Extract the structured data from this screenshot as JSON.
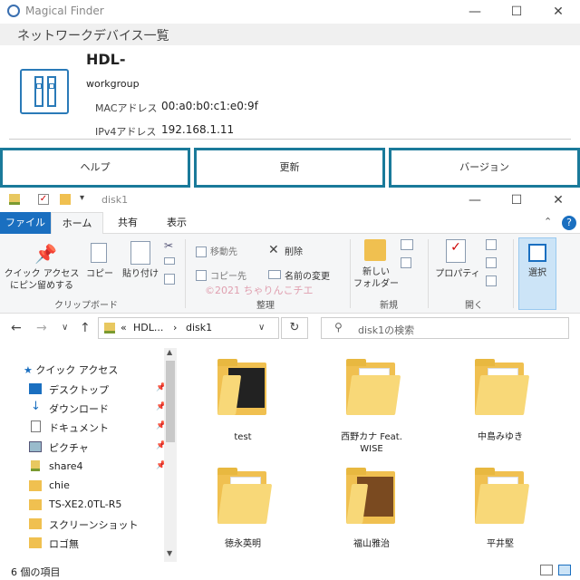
{
  "app": {
    "title": "Magical Finder",
    "subtitle": "ネットワークデバイス一覧"
  },
  "device": {
    "name": "HDL-",
    "workgroup": "workgroup",
    "mac_label": "MACアドレス",
    "mac_value": "00:a0:b0:c1:e0:9f",
    "ip_label": "IPv4アドレス",
    "ip_value": "192.168.1.11"
  },
  "actions": {
    "help": "ヘルプ",
    "refresh": "更新",
    "version": "バージョン"
  },
  "explorer": {
    "title": "disk1",
    "tabs": [
      "ファイル",
      "ホーム",
      "共有",
      "表示"
    ],
    "ribbon": {
      "pin": "クイック アクセス\nにピン留めする",
      "copy": "コピー",
      "paste": "貼り付け",
      "clipboard_group": "クリップボード",
      "move_to": "移動先",
      "copy_to": "コピー先",
      "delete": "削除",
      "rename": "名前の変更",
      "organize_group": "整理",
      "new_folder": "新しい\nフォルダー",
      "new_group": "新規",
      "properties": "プロパティ",
      "open_group": "開く",
      "select": "選択"
    },
    "watermark": "©2021 ちゃりんこチエ",
    "address": {
      "prefix": "«",
      "part1": "HDL...",
      "sep": "›",
      "part2": "disk1"
    },
    "search_placeholder": "disk1の検索",
    "nav": [
      {
        "label": "クイック アクセス",
        "icon": "star-icon"
      },
      {
        "label": "デスクトップ",
        "icon": "desktop-icon",
        "pinned": true
      },
      {
        "label": "ダウンロード",
        "icon": "download-icon",
        "pinned": true
      },
      {
        "label": "ドキュメント",
        "icon": "document-icon",
        "pinned": true
      },
      {
        "label": "ピクチャ",
        "icon": "picture-icon",
        "pinned": true
      },
      {
        "label": "share4",
        "icon": "network-folder-icon",
        "pinned": true
      },
      {
        "label": "chie",
        "icon": "folder-icon"
      },
      {
        "label": "TS-XE2.0TL-R5",
        "icon": "folder-icon"
      },
      {
        "label": "スクリーンショット",
        "icon": "folder-icon"
      },
      {
        "label": "ロゴ無",
        "icon": "folder-icon"
      }
    ],
    "items": [
      {
        "label": "test"
      },
      {
        "label": "西野カナ Feat.\nWISE"
      },
      {
        "label": "中島みゆき"
      },
      {
        "label": "徳永英明"
      },
      {
        "label": "福山雅治"
      },
      {
        "label": "平井堅"
      }
    ],
    "status": "6 個の項目"
  }
}
